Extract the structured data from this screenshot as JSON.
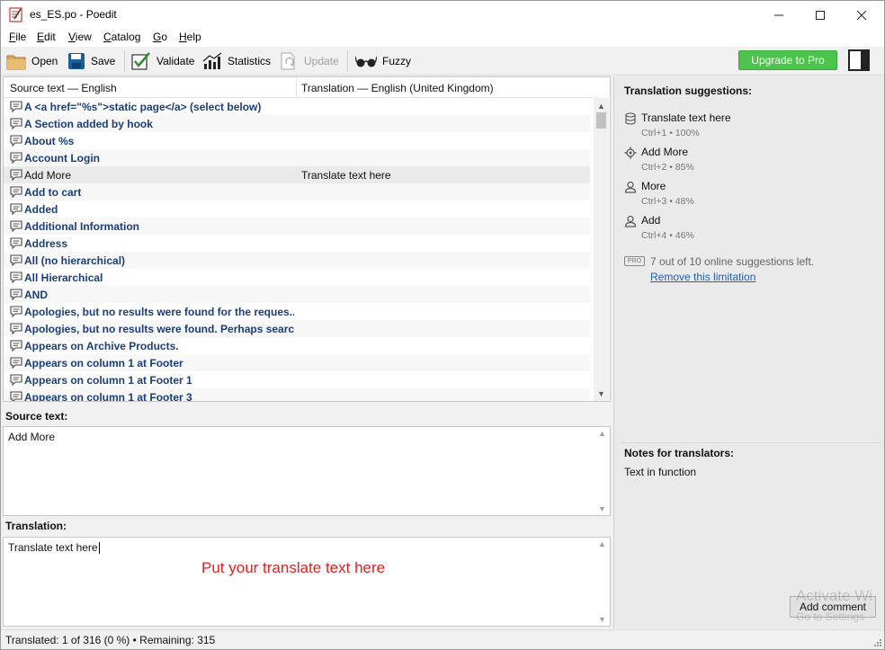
{
  "window": {
    "title": "es_ES.po - Poedit",
    "min_icon": "minimize-icon",
    "max_icon": "maximize-icon",
    "close_icon": "close-icon"
  },
  "menu": [
    {
      "label": "File",
      "key": "F"
    },
    {
      "label": "Edit",
      "key": "E"
    },
    {
      "label": "View",
      "key": "V"
    },
    {
      "label": "Catalog",
      "key": "C"
    },
    {
      "label": "Go",
      "key": "G"
    },
    {
      "label": "Help",
      "key": "H"
    }
  ],
  "toolbar": {
    "open": "Open",
    "save": "Save",
    "validate": "Validate",
    "statistics": "Statistics",
    "update": "Update",
    "fuzzy": "Fuzzy",
    "upgrade": "Upgrade to Pro"
  },
  "list": {
    "col_source": "Source text — English",
    "col_translation": "Translation — English (United Kingdom)",
    "rows": [
      {
        "source": "A <a href=\"%s\">static page</a> (select below)",
        "translation": "",
        "state": "untranslated"
      },
      {
        "source": "A Section added by hook",
        "translation": "",
        "state": "untranslated"
      },
      {
        "source": "About %s",
        "translation": "",
        "state": "untranslated"
      },
      {
        "source": "Account Login",
        "translation": "",
        "state": "untranslated"
      },
      {
        "source": "Add More",
        "translation": "Translate text here",
        "state": "translated"
      },
      {
        "source": "Add to cart",
        "translation": "",
        "state": "untranslated"
      },
      {
        "source": "Added",
        "translation": "",
        "state": "untranslated"
      },
      {
        "source": "Additional Information",
        "translation": "",
        "state": "untranslated"
      },
      {
        "source": "Address",
        "translation": "",
        "state": "untranslated"
      },
      {
        "source": "All (no hierarchical)",
        "translation": "",
        "state": "untranslated"
      },
      {
        "source": "All Hierarchical",
        "translation": "",
        "state": "untranslated"
      },
      {
        "source": "AND",
        "translation": "",
        "state": "untranslated"
      },
      {
        "source": "Apologies, but no results were found for the reques...",
        "translation": "",
        "state": "untranslated"
      },
      {
        "source": "Apologies, but no results were found. Perhaps searc...",
        "translation": "",
        "state": "untranslated"
      },
      {
        "source": "Appears on Archive Products.",
        "translation": "",
        "state": "untranslated"
      },
      {
        "source": "Appears on column 1 at Footer",
        "translation": "",
        "state": "untranslated"
      },
      {
        "source": "Appears on column 1 at Footer 1",
        "translation": "",
        "state": "untranslated"
      },
      {
        "source": "Appears on column 1 at Footer 3",
        "translation": "",
        "state": "untranslated"
      }
    ]
  },
  "source_panel": {
    "label": "Source text:",
    "text": "Add More"
  },
  "translation_panel": {
    "label": "Translation:",
    "text": "Translate text here",
    "hint": "Put your translate text here"
  },
  "status": {
    "text": "Translated: 1 of 316 (0 %)  •  Remaining: 315"
  },
  "sidebar": {
    "suggestions_title": "Translation suggestions:",
    "suggestions": [
      {
        "text": "Translate text here",
        "meta": "Ctrl+1 • 100%",
        "icon": "database-icon"
      },
      {
        "text": "Add More",
        "meta": "Ctrl+2 • 85%",
        "icon": "gear-icon"
      },
      {
        "text": "More",
        "meta": "Ctrl+3 • 48%",
        "icon": "user-icon"
      },
      {
        "text": "Add",
        "meta": "Ctrl+4 • 46%",
        "icon": "user-icon"
      }
    ],
    "pro_badge": "PRO",
    "pro_text": "7 out of 10 online suggestions left.",
    "pro_link": "Remove this limitation",
    "notes_title": "Notes for translators:",
    "notes_text": "Text in function",
    "add_comment": "Add comment"
  },
  "watermark": {
    "line1": "Activate Wi",
    "line2": "Go to Settings"
  },
  "colors": {
    "accent_green": "#4cc44c",
    "untranslated_text": "#1a3e7a",
    "link": "#1f5fb5",
    "hint_red": "#e02020"
  }
}
